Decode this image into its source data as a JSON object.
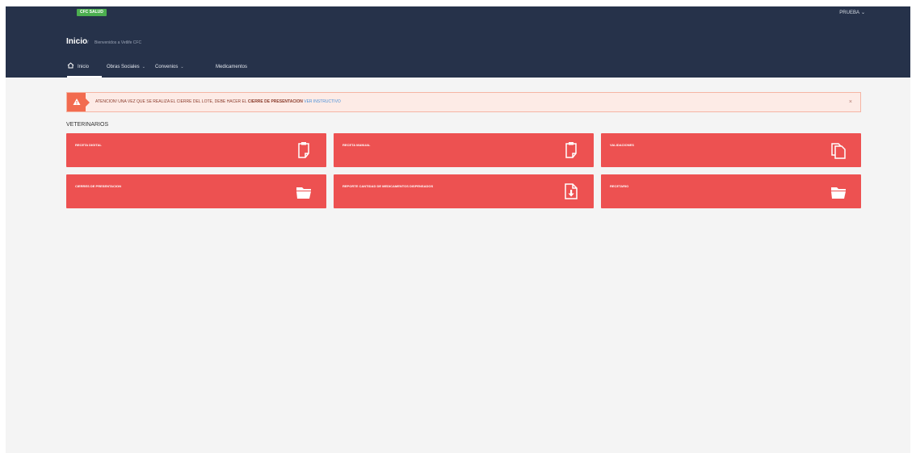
{
  "header": {
    "brand_badge": "CFC SALUD",
    "user_menu_label": "PRUEBA",
    "title": "Inicio",
    "breadcrumb_separator": "/",
    "breadcrumb_subtitle": "Bienvenidos a Vetlife CFC"
  },
  "nav": {
    "items": [
      {
        "label": "Inicio",
        "icon": "home-icon",
        "active": true
      },
      {
        "label": "Obras Sociales",
        "icon": "chevron-down-icon"
      },
      {
        "label": "Convenios",
        "icon": "chevron-down-icon"
      },
      {
        "label": "Medicamentos"
      }
    ]
  },
  "alert": {
    "icon": "warning-icon",
    "text_part1": "ATENCION! UNA VEZ QUE SE REALIZA EL CIERRE DEL LOTE, DEBE HACER EL",
    "text_bold": "CIERRE DE PRESENTACION",
    "link_text": "VER INSTRUCTIVO",
    "close_label": "×",
    "colors": {
      "badge": "#f26b4f",
      "background": "#fdebe6",
      "link": "#4a90d9"
    }
  },
  "section": {
    "title": "VETERINARIOS"
  },
  "tiles": [
    {
      "label": "RECETA DIGITAL",
      "icon": "clipboard-icon"
    },
    {
      "label": "RECETA MANUAL",
      "icon": "clipboard-icon"
    },
    {
      "label": "VALIDACIONES",
      "icon": "copy-documents-icon"
    },
    {
      "label": "CIERRES DE PRESENTACION",
      "icon": "folder-open-icon"
    },
    {
      "label": "REPORTE CANTIDAD DE MEDICAMENTOS DISPENSADOS",
      "icon": "file-download-icon"
    },
    {
      "label": "RECETARIO",
      "icon": "folder-open-icon"
    }
  ],
  "colors": {
    "topbar": "#26324a",
    "tile": "#ed5151",
    "page_background": "#f4f4f4",
    "brand_badge": "#4caf50"
  }
}
